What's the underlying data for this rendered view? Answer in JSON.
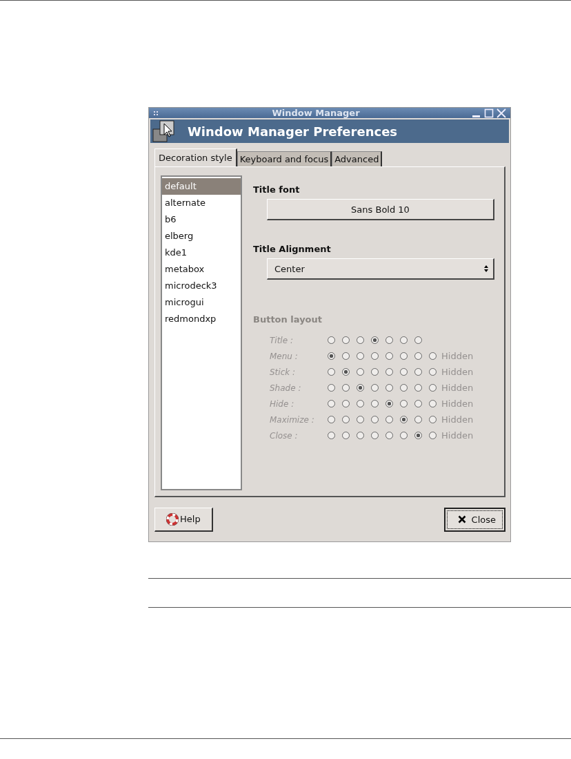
{
  "window": {
    "title": "Window Manager"
  },
  "header": {
    "title": "Window Manager Preferences"
  },
  "tabs": [
    {
      "label": "Decoration style",
      "selected": true
    },
    {
      "label": "Keyboard and focus",
      "selected": false
    },
    {
      "label": "Advanced",
      "selected": false
    }
  ],
  "themes": [
    {
      "label": "default",
      "selected": true
    },
    {
      "label": "alternate",
      "selected": false
    },
    {
      "label": "b6",
      "selected": false
    },
    {
      "label": "elberg",
      "selected": false
    },
    {
      "label": "kde1",
      "selected": false
    },
    {
      "label": "metabox",
      "selected": false
    },
    {
      "label": "microdeck3",
      "selected": false
    },
    {
      "label": "microgui",
      "selected": false
    },
    {
      "label": "redmondxp",
      "selected": false
    }
  ],
  "title_font": {
    "label": "Title font",
    "value": "Sans Bold 10"
  },
  "title_alignment": {
    "label": "Title Alignment",
    "value": "Center"
  },
  "button_layout": {
    "label": "Button layout",
    "disabled": true,
    "rows": [
      {
        "label": "Title :",
        "radios": [
          {
            "selected": false
          },
          {
            "selected": false
          },
          {
            "selected": false
          },
          {
            "selected": true
          },
          {
            "selected": false
          },
          {
            "selected": false
          },
          {
            "selected": false
          }
        ]
      },
      {
        "label": "Menu :",
        "radios": [
          {
            "selected": true
          },
          {
            "selected": false
          },
          {
            "selected": false
          },
          {
            "selected": false
          },
          {
            "selected": false
          },
          {
            "selected": false
          },
          {
            "selected": false
          },
          {
            "selected": false
          }
        ],
        "hidden_label": "Hidden"
      },
      {
        "label": "Stick :",
        "radios": [
          {
            "selected": false
          },
          {
            "selected": true
          },
          {
            "selected": false
          },
          {
            "selected": false
          },
          {
            "selected": false
          },
          {
            "selected": false
          },
          {
            "selected": false
          },
          {
            "selected": false
          }
        ],
        "hidden_label": "Hidden"
      },
      {
        "label": "Shade :",
        "radios": [
          {
            "selected": false
          },
          {
            "selected": false
          },
          {
            "selected": true
          },
          {
            "selected": false
          },
          {
            "selected": false
          },
          {
            "selected": false
          },
          {
            "selected": false
          },
          {
            "selected": false
          }
        ],
        "hidden_label": "Hidden"
      },
      {
        "label": "Hide :",
        "radios": [
          {
            "selected": false
          },
          {
            "selected": false
          },
          {
            "selected": false
          },
          {
            "selected": false
          },
          {
            "selected": true
          },
          {
            "selected": false
          },
          {
            "selected": false
          },
          {
            "selected": false
          }
        ],
        "hidden_label": "Hidden"
      },
      {
        "label": "Maximize :",
        "radios": [
          {
            "selected": false
          },
          {
            "selected": false
          },
          {
            "selected": false
          },
          {
            "selected": false
          },
          {
            "selected": false
          },
          {
            "selected": true
          },
          {
            "selected": false
          },
          {
            "selected": false
          }
        ],
        "hidden_label": "Hidden"
      },
      {
        "label": "Close :",
        "radios": [
          {
            "selected": false
          },
          {
            "selected": false
          },
          {
            "selected": false
          },
          {
            "selected": false
          },
          {
            "selected": false
          },
          {
            "selected": false
          },
          {
            "selected": true
          },
          {
            "selected": false
          }
        ],
        "hidden_label": "Hidden"
      }
    ]
  },
  "buttons": [
    {
      "kind": "help",
      "label": "Help"
    },
    {
      "kind": "close",
      "label": "Close"
    }
  ]
}
